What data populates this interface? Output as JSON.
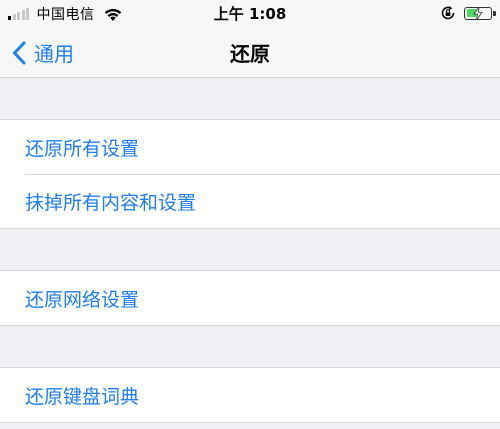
{
  "status_bar": {
    "carrier": "中国电信",
    "time": "上午 1:08",
    "signal_bars_filled": 1,
    "battery_level": 0.5,
    "icons": [
      "signal-icon",
      "wifi-icon",
      "rotation-lock-icon",
      "battery-charging-icon"
    ]
  },
  "nav": {
    "back_label": "通用",
    "title": "还原"
  },
  "groups": [
    {
      "items": [
        "还原所有设置",
        "抹掉所有内容和设置"
      ]
    },
    {
      "items": [
        "还原网络设置"
      ]
    },
    {
      "items": [
        "还原键盘词典"
      ]
    }
  ],
  "colors": {
    "accent": "#1d7ef5",
    "background": "#efeff4",
    "separator": "#d8d8dc",
    "battery": "#4cd964"
  }
}
